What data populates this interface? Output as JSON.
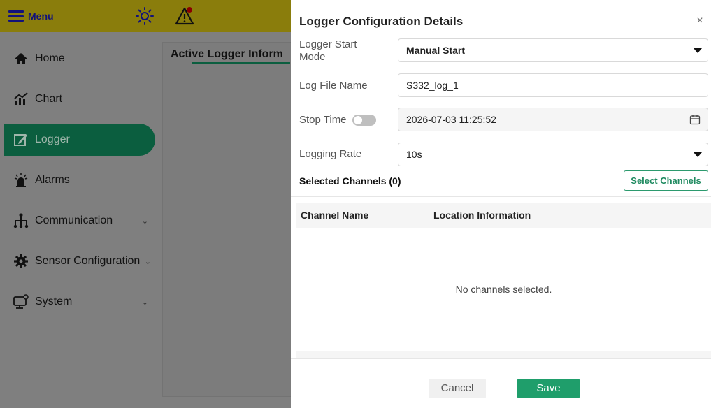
{
  "topbar": {
    "menu_label": "Menu"
  },
  "sidebar": {
    "items": [
      {
        "label": "Home",
        "icon": "home-icon",
        "active": false
      },
      {
        "label": "Chart",
        "icon": "chart-icon",
        "active": false
      },
      {
        "label": "Logger",
        "icon": "logger-icon",
        "active": true
      },
      {
        "label": "Alarms",
        "icon": "alarm-icon",
        "active": false
      },
      {
        "label": "Communication",
        "icon": "network-icon",
        "active": false,
        "expandable": true
      },
      {
        "label": "Sensor Configuration",
        "icon": "gear-icon",
        "active": false,
        "expandable": true
      },
      {
        "label": "System",
        "icon": "monitor-icon",
        "active": false,
        "expandable": true
      }
    ]
  },
  "content": {
    "title": "Active Logger Inform"
  },
  "dialog": {
    "title": "Logger Configuration Details",
    "close_glyph": "×",
    "start_mode": {
      "label": "Logger Start Mode",
      "value": "Manual Start"
    },
    "file_name": {
      "label": "Log File Name",
      "value": "S332_log_1"
    },
    "stop_time": {
      "label": "Stop Time",
      "value": "2026-07-03 11:25:52",
      "enabled": false
    },
    "rate": {
      "label": "Logging Rate",
      "value": "10s"
    },
    "selected_channels": {
      "label": "Selected Channels (0)",
      "button": "Select Channels"
    },
    "table": {
      "columns": [
        "Channel Name",
        "Location Information"
      ],
      "empty_text": "No channels selected."
    },
    "cancel_label": "Cancel",
    "save_label": "Save"
  },
  "colors": {
    "accent": "#1f9e6b",
    "sidebar_active": "#0b5e3f",
    "topbar": "#8a7d0c"
  }
}
